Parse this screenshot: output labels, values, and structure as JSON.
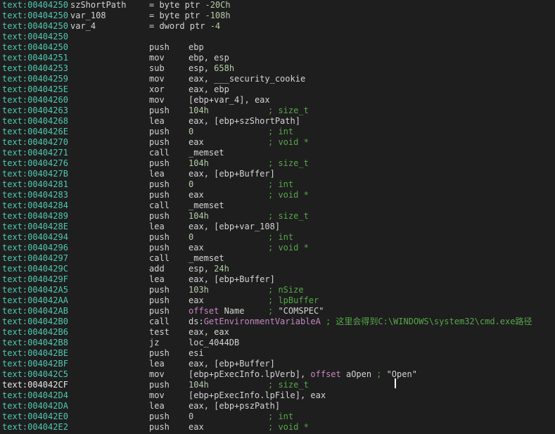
{
  "listing": [
    {
      "addr": "text:00404250",
      "label": "szShortPath",
      "def": "= byte ptr -20Ch"
    },
    {
      "addr": "text:00404250",
      "label": "var_108",
      "def": "= byte ptr -108h"
    },
    {
      "addr": "text:00404250",
      "label": "var_4",
      "def": "= dword ptr -4"
    },
    {
      "addr": "text:00404250"
    },
    {
      "addr": "text:00404250",
      "mn": "push",
      "op": "ebp"
    },
    {
      "addr": "text:00404251",
      "mn": "mov",
      "op": "ebp, esp"
    },
    {
      "addr": "text:00404253",
      "mn": "sub",
      "op": "esp, 658h"
    },
    {
      "addr": "text:00404259",
      "mn": "mov",
      "op": "eax, ___security_cookie"
    },
    {
      "addr": "text:0040425E",
      "mn": "xor",
      "op": "eax, ebp"
    },
    {
      "addr": "text:00404260",
      "mn": "mov",
      "op": "[ebp+var_4], eax"
    },
    {
      "addr": "text:00404263",
      "mn": "push",
      "op": "104h",
      "cm": "; size_t"
    },
    {
      "addr": "text:00404268",
      "mn": "lea",
      "op": "eax, [ebp+szShortPath]"
    },
    {
      "addr": "text:0040426E",
      "mn": "push",
      "op": "0",
      "cm": "; int"
    },
    {
      "addr": "text:00404270",
      "mn": "push",
      "op": "eax",
      "cm": "; void *"
    },
    {
      "addr": "text:00404271",
      "mn": "call",
      "op": "_memset"
    },
    {
      "addr": "text:00404276",
      "mn": "push",
      "op": "104h",
      "cm": "; size_t"
    },
    {
      "addr": "text:0040427B",
      "mn": "lea",
      "op": "eax, [ebp+Buffer]"
    },
    {
      "addr": "text:00404281",
      "mn": "push",
      "op": "0",
      "cm": "; int"
    },
    {
      "addr": "text:00404283",
      "mn": "push",
      "op": "eax",
      "cm": "; void *"
    },
    {
      "addr": "text:00404284",
      "mn": "call",
      "op": "_memset"
    },
    {
      "addr": "text:00404289",
      "mn": "push",
      "op": "104h",
      "cm": "; size_t"
    },
    {
      "addr": "text:0040428E",
      "mn": "lea",
      "op": "eax, [ebp+var_108]"
    },
    {
      "addr": "text:00404294",
      "mn": "push",
      "op": "0",
      "cm": "; int"
    },
    {
      "addr": "text:00404296",
      "mn": "push",
      "op": "eax",
      "cm": "; void *"
    },
    {
      "addr": "text:00404297",
      "mn": "call",
      "op": "_memset"
    },
    {
      "addr": "text:0040429C",
      "mn": "add",
      "op": "esp, 24h"
    },
    {
      "addr": "text:0040429F",
      "mn": "lea",
      "op": "eax, [ebp+Buffer]"
    },
    {
      "addr": "text:004042A5",
      "mn": "push",
      "op": "103h",
      "cm": "; nSize"
    },
    {
      "addr": "text:004042AA",
      "mn": "push",
      "op": "eax",
      "cm": "; lpBuffer"
    },
    {
      "addr": "text:004042AB",
      "mn": "push",
      "op": "offset Name",
      "cm": "; \"COMSPEC\""
    },
    {
      "addr": "text:004042B0",
      "mn": "call",
      "op": "ds:GetEnvironmentVariableA",
      "cm": "; 这里会得到C:\\WINDOWS\\system32\\cmd.exe路径"
    },
    {
      "addr": "text:004042B6",
      "mn": "test",
      "op": "eax, eax"
    },
    {
      "addr": "text:004042B8",
      "mn": "jz",
      "op": "loc_4044DB"
    },
    {
      "addr": "text:004042BE",
      "mn": "push",
      "op": "esi"
    },
    {
      "addr": "text:004042BF",
      "mn": "lea",
      "op": "eax, [ebp+Buffer]"
    },
    {
      "addr": "text:004042C5",
      "mn": "mov",
      "op": "[ebp+pExecInfo.lpVerb], offset aOpen",
      "cm": "; \"Open\""
    },
    {
      "addr": "text:004042CF",
      "mn": "push",
      "op": "104h",
      "cm": "; size_t",
      "selected": true
    },
    {
      "addr": "text:004042D4",
      "mn": "mov",
      "op": "[ebp+pExecInfo.lpFile], eax"
    },
    {
      "addr": "text:004042DA",
      "mn": "lea",
      "op": "eax, [ebp+pszPath]"
    },
    {
      "addr": "text:004042E0",
      "mn": "push",
      "op": "0",
      "cm": "; int"
    },
    {
      "addr": "text:004042E2",
      "mn": "push",
      "op": "eax",
      "cm": "; void *"
    }
  ],
  "colors": {
    "background": "#1e1e1e",
    "address": "#4ec9b0",
    "text": "#d4d4d4",
    "number": "#b5cea8",
    "comment": "#57a64a",
    "keyword": "#c586c0"
  }
}
